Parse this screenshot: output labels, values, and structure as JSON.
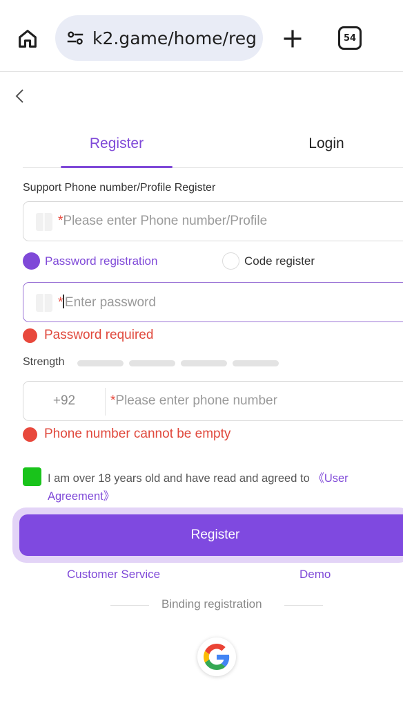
{
  "browser": {
    "url": "k2.game/home/reg",
    "tab_count": "54"
  },
  "tabs": {
    "register": "Register",
    "login": "Login"
  },
  "form": {
    "support_label": "Support Phone number/Profile Register",
    "account_placeholder": "Please enter Phone number/Profile",
    "required_mark": "*",
    "radio_password": "Password registration",
    "radio_code": "Code register",
    "password_placeholder": "Enter password",
    "password_error": "Password required",
    "strength_label": "Strength",
    "country_code": "+92",
    "phone_placeholder": "Please enter phone number",
    "phone_error": "Phone number cannot be empty",
    "agreement_text": "I am over 18 years old and have read and agreed to ",
    "agreement_link": "《User Agreement》",
    "register_button": "Register"
  },
  "footer": {
    "customer_service": "Customer Service",
    "demo": "Demo",
    "binding_registration": "Binding registration"
  },
  "colors": {
    "accent": "#7f49d8",
    "error": "#e8483c",
    "checkbox": "#19c31b"
  },
  "icons": [
    "home-icon",
    "tune-icon",
    "plus-icon",
    "tabs-counter-icon",
    "back-arrow-icon",
    "google-icon"
  ]
}
